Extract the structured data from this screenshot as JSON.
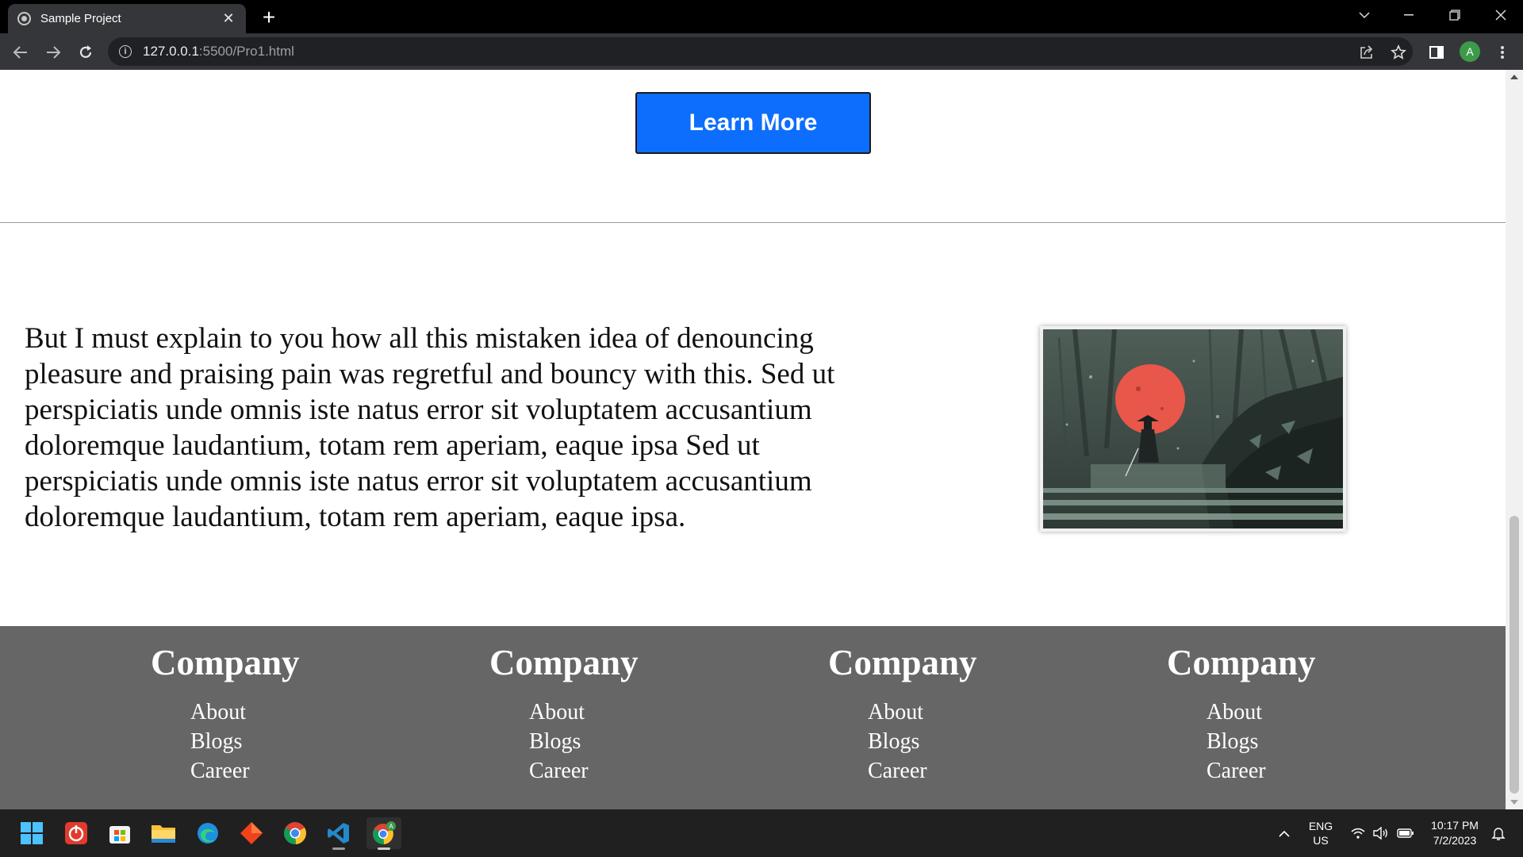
{
  "browser": {
    "tab_title": "Sample Project",
    "tab_close": "✕",
    "new_tab": "+",
    "url_host": "127.0.0.1",
    "url_rest": ":5500/Pro1.html",
    "profile_initial": "A"
  },
  "page": {
    "cta_label": "Learn More",
    "paragraph": "But I must explain to you how all this mistaken idea of denouncing pleasure and praising pain was regretful and bouncy with this. Sed ut perspiciatis unde omnis iste natus error sit voluptatem accusantium doloremque laudantium, totam rem aperiam, eaque ipsa Sed ut perspiciatis unde omnis iste natus error sit voluptatem accusantium doloremque laudantium, totam rem aperiam, eaque ipsa.",
    "image_icon": "samurai-red-moon-illustration"
  },
  "footer": {
    "columns": [
      {
        "heading": "Company",
        "links": [
          "About",
          "Blogs",
          "Career"
        ]
      },
      {
        "heading": "Company",
        "links": [
          "About",
          "Blogs",
          "Career"
        ]
      },
      {
        "heading": "Company",
        "links": [
          "About",
          "Blogs",
          "Career"
        ]
      },
      {
        "heading": "Company",
        "links": [
          "About",
          "Blogs",
          "Career"
        ]
      }
    ]
  },
  "taskbar": {
    "lang_top": "ENG",
    "lang_bottom": "US",
    "time": "10:17 PM",
    "date": "7/2/2023"
  },
  "colors": {
    "cta_blue": "#0d6efd",
    "footer_gray": "#666666",
    "chrome_dark": "#35363a"
  }
}
